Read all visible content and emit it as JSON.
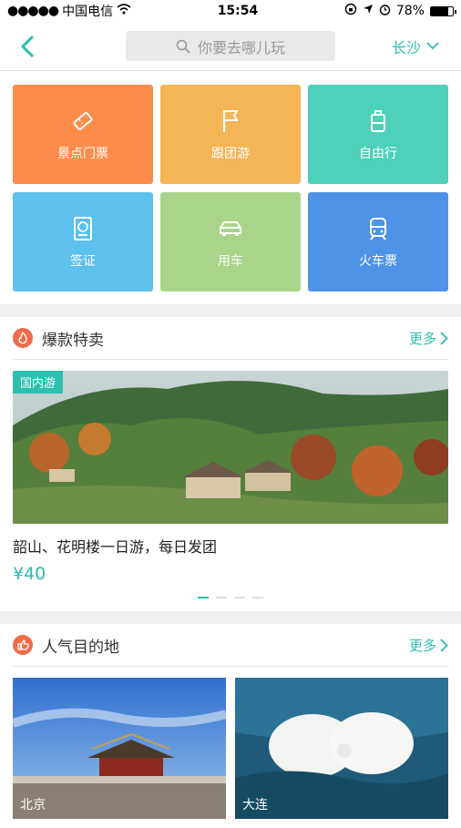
{
  "status_bar": {
    "carrier": "中国电信",
    "time": "15:54",
    "battery": "78%",
    "battery_level": 0.78
  },
  "nav": {
    "search_placeholder": "你要去哪儿玩",
    "city": "长沙"
  },
  "categories": [
    {
      "label": "景点门票",
      "icon": "ticket-icon",
      "color": "#fb8c4a"
    },
    {
      "label": "跟团游",
      "icon": "flag-icon",
      "color": "#f4b556"
    },
    {
      "label": "自由行",
      "icon": "luggage-icon",
      "color": "#4fd0b8"
    },
    {
      "label": "签证",
      "icon": "passport-icon",
      "color": "#5ec0ec"
    },
    {
      "label": "用车",
      "icon": "car-icon",
      "color": "#a8d58a"
    },
    {
      "label": "火车票",
      "icon": "train-icon",
      "color": "#4f93e8"
    }
  ],
  "hot_deals": {
    "title": "爆款特卖",
    "more": "更多",
    "tag": "国内游",
    "deal_title": "韶山、花明楼一日游，每日发团",
    "price": "¥40"
  },
  "destinations": {
    "title": "人气目的地",
    "more": "更多",
    "items": [
      {
        "label": "北京"
      },
      {
        "label": "大连"
      }
    ]
  },
  "colors": {
    "accent": "#2bbfae",
    "section_icon": "#f26b49"
  }
}
